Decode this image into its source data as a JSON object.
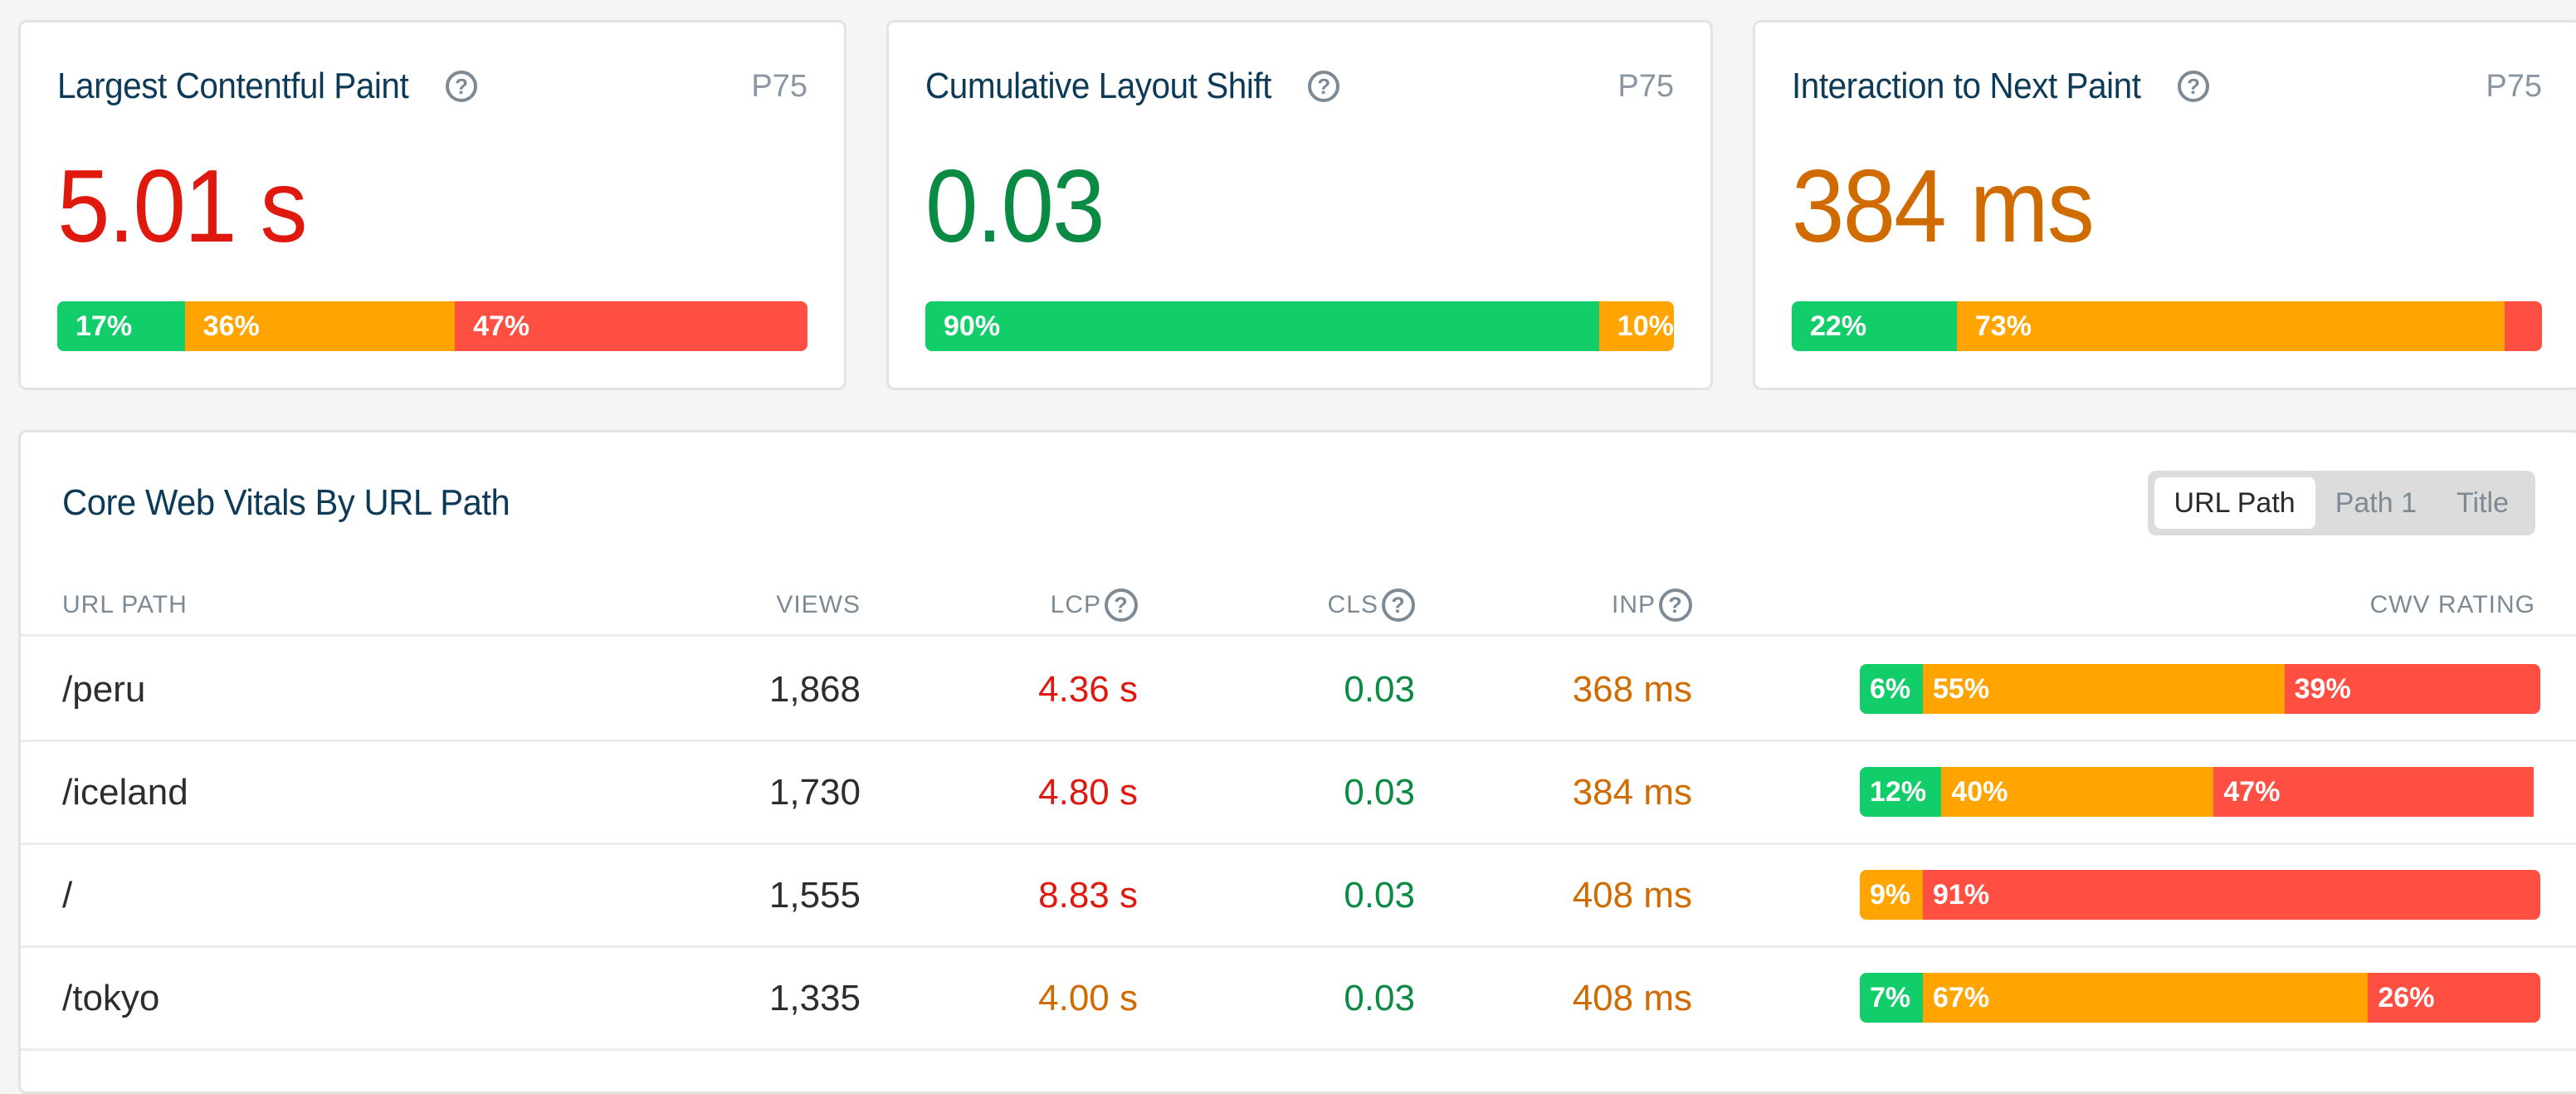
{
  "colors": {
    "good": "#12ce6a",
    "needs_improvement": "#ffa400",
    "poor": "#ff4e42",
    "good_text": "#0b8a44",
    "needs_improvement_text": "#d06b00",
    "poor_text": "#e0190f",
    "title": "#0d3a57"
  },
  "metrics": [
    {
      "title": "Largest Contentful Paint",
      "help_icon": "question-circle-icon",
      "percentile": "P75",
      "value": "5.01 s",
      "rating": "poor",
      "distribution": [
        {
          "rating": "good",
          "percent": 17,
          "label": "17%"
        },
        {
          "rating": "ni",
          "percent": 36,
          "label": "36%"
        },
        {
          "rating": "poor",
          "percent": 47,
          "label": "47%"
        }
      ]
    },
    {
      "title": "Cumulative Layout Shift",
      "help_icon": "question-circle-icon",
      "percentile": "P75",
      "value": "0.03",
      "rating": "good",
      "distribution": [
        {
          "rating": "good",
          "percent": 90,
          "label": "90%"
        },
        {
          "rating": "ni",
          "percent": 10,
          "label": "10%"
        }
      ]
    },
    {
      "title": "Interaction to Next Paint",
      "help_icon": "question-circle-icon",
      "percentile": "P75",
      "value": "384 ms",
      "rating": "ni",
      "distribution": [
        {
          "rating": "good",
          "percent": 22,
          "label": "22%"
        },
        {
          "rating": "ni",
          "percent": 73,
          "label": "73%"
        },
        {
          "rating": "poor",
          "percent": 5,
          "label": ""
        }
      ]
    }
  ],
  "table": {
    "title": "Core Web Vitals By URL Path",
    "toggle": {
      "options": [
        "URL Path",
        "Path 1",
        "Title"
      ],
      "selected": "URL Path"
    },
    "columns": {
      "path": "URL PATH",
      "views": "VIEWS",
      "lcp": "LCP",
      "cls": "CLS",
      "inp": "INP",
      "cwv": "CWV RATING"
    },
    "rows": [
      {
        "path": "/peru",
        "views": "1,868",
        "lcp": {
          "value": "4.36 s",
          "rating": "poor"
        },
        "cls": {
          "value": "0.03",
          "rating": "good"
        },
        "inp": {
          "value": "368 ms",
          "rating": "ni"
        },
        "cwv": [
          {
            "rating": "good",
            "percent": 6,
            "label": "6%"
          },
          {
            "rating": "ni",
            "percent": 55,
            "label": "55%"
          },
          {
            "rating": "poor",
            "percent": 39,
            "label": "39%"
          }
        ]
      },
      {
        "path": "/iceland",
        "views": "1,730",
        "lcp": {
          "value": "4.80 s",
          "rating": "poor"
        },
        "cls": {
          "value": "0.03",
          "rating": "good"
        },
        "inp": {
          "value": "384 ms",
          "rating": "ni"
        },
        "cwv": [
          {
            "rating": "good",
            "percent": 12,
            "label": "12%"
          },
          {
            "rating": "ni",
            "percent": 40,
            "label": "40%"
          },
          {
            "rating": "poor",
            "percent": 47,
            "label": "47%"
          }
        ]
      },
      {
        "path": "/",
        "views": "1,555",
        "lcp": {
          "value": "8.83 s",
          "rating": "poor"
        },
        "cls": {
          "value": "0.03",
          "rating": "good"
        },
        "inp": {
          "value": "408 ms",
          "rating": "ni"
        },
        "cwv": [
          {
            "rating": "ni",
            "percent": 9,
            "label": "9%"
          },
          {
            "rating": "poor",
            "percent": 91,
            "label": "91%"
          }
        ]
      },
      {
        "path": "/tokyo",
        "views": "1,335",
        "lcp": {
          "value": "4.00 s",
          "rating": "ni"
        },
        "cls": {
          "value": "0.03",
          "rating": "good"
        },
        "inp": {
          "value": "408 ms",
          "rating": "ni"
        },
        "cwv": [
          {
            "rating": "good",
            "percent": 7,
            "label": "7%"
          },
          {
            "rating": "ni",
            "percent": 67,
            "label": "67%"
          },
          {
            "rating": "poor",
            "percent": 26,
            "label": "26%"
          }
        ]
      }
    ]
  }
}
